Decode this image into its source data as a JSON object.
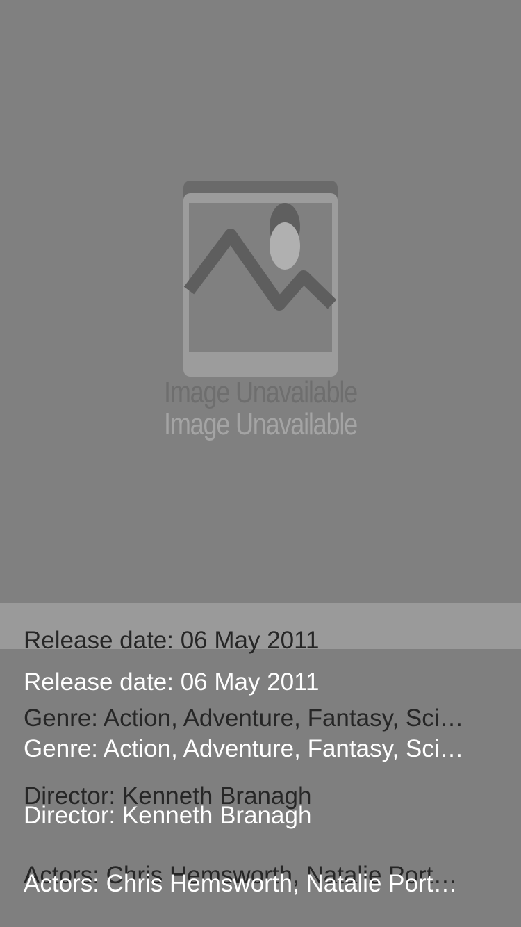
{
  "poster": {
    "placeholder_icon": "image-unavailable-icon",
    "placeholder_text": "Image Unavailable"
  },
  "details": {
    "release_date": "Release date: 06 May 2011",
    "genre": "Genre: Action, Adventure, Fantasy, Sci…",
    "director": "Director: Kenneth Branagh",
    "actors": "Actors: Chris Hemsworth, Natalie Port…"
  },
  "colors": {
    "background": "#7f7f7f",
    "band": "#9a9a9a",
    "dark_text": "#262626",
    "light_text": "#ffffff"
  }
}
